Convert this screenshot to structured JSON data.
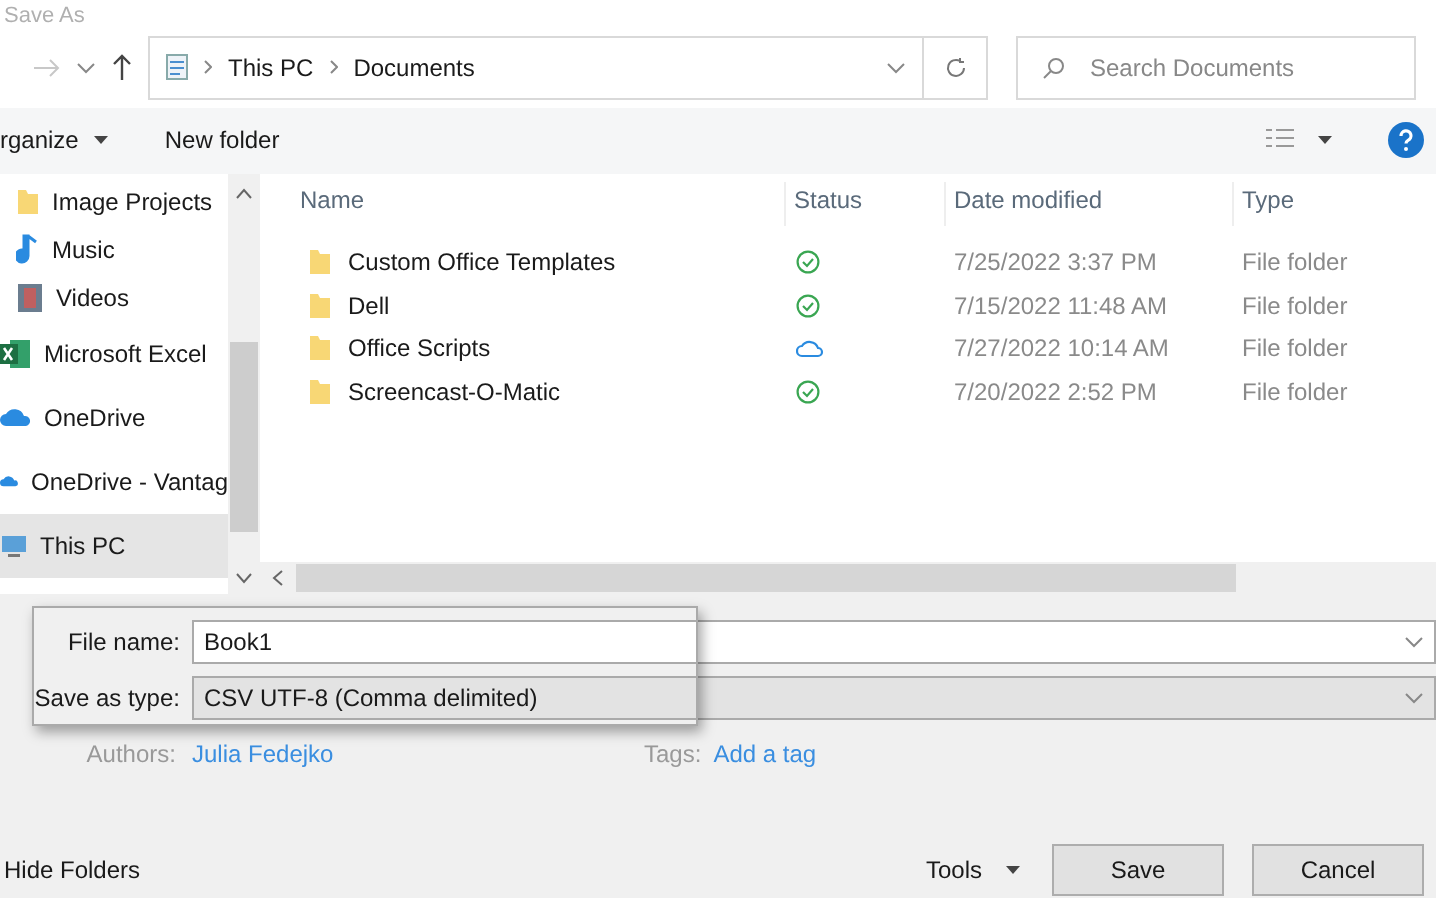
{
  "window": {
    "title": "Save As"
  },
  "address_bar": {
    "path": [
      {
        "label": "This PC"
      },
      {
        "label": "Documents"
      }
    ],
    "search_placeholder": "Search Documents"
  },
  "toolbar": {
    "organize": "rganize",
    "new_folder": "New folder"
  },
  "sidebar": {
    "items": [
      {
        "label": "Image Projects",
        "kind": "folder",
        "selected": false
      },
      {
        "label": "Music",
        "kind": "music",
        "selected": false
      },
      {
        "label": "Videos",
        "kind": "video",
        "selected": false
      },
      {
        "label": "Microsoft Excel",
        "kind": "excel",
        "selected": false
      },
      {
        "label": "OneDrive",
        "kind": "cloud",
        "selected": false
      },
      {
        "label": "OneDrive - Vantag",
        "kind": "cloud",
        "selected": false
      },
      {
        "label": "This PC",
        "kind": "pc",
        "selected": true
      }
    ]
  },
  "table": {
    "columns": [
      "Name",
      "Status",
      "Date modified",
      "Type"
    ],
    "rows": [
      {
        "name": "Custom Office Templates",
        "synced": true,
        "date": "7/25/2022 3:37 PM",
        "type": "File folder"
      },
      {
        "name": "Dell",
        "synced": true,
        "date": "7/15/2022 11:48 AM",
        "type": "File folder"
      },
      {
        "name": "Office Scripts",
        "synced": false,
        "date": "7/27/2022 10:14 AM",
        "type": "File folder"
      },
      {
        "name": "Screencast-O-Matic",
        "synced": true,
        "date": "7/20/2022 2:52 PM",
        "type": "File folder"
      }
    ]
  },
  "form": {
    "file_name_label": "File name:",
    "file_name": "Book1",
    "type_label": "Save as type:",
    "type": "CSV UTF-8 (Comma delimited)",
    "authors_label": "Authors:",
    "authors": "Julia Fedejko",
    "tags_label": "Tags:",
    "tags_link": "Add a tag"
  },
  "footer": {
    "hide_folders": "Hide Folders",
    "tools": "Tools",
    "save": "Save",
    "cancel": "Cancel"
  }
}
